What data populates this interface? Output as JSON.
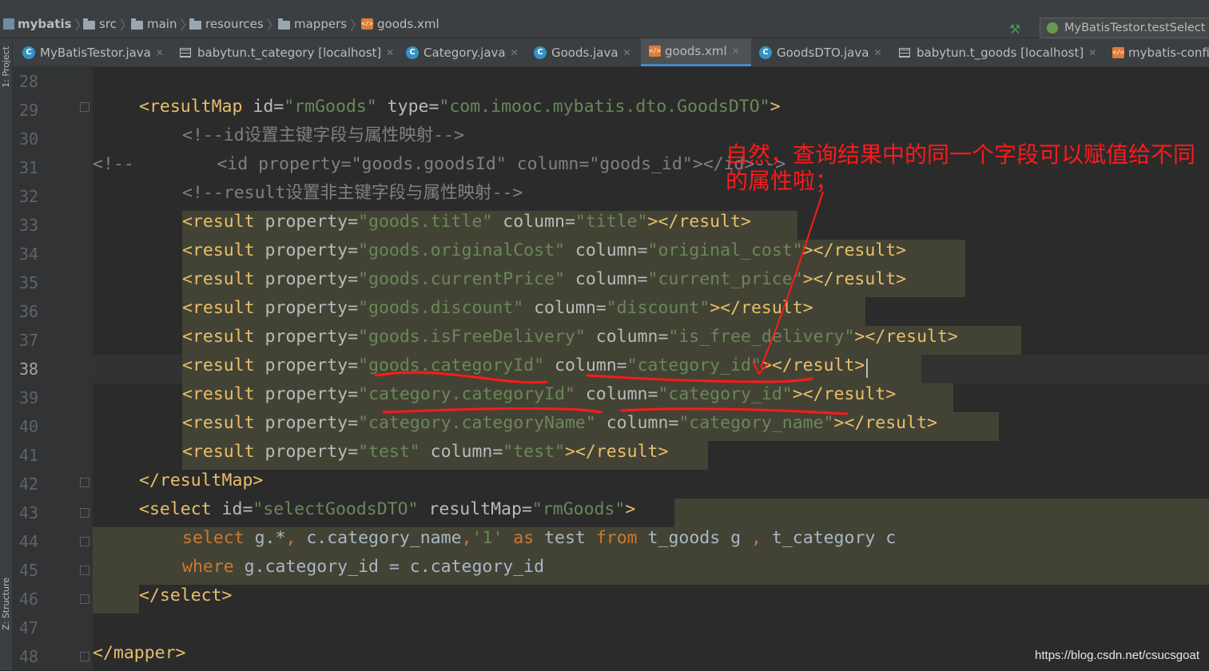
{
  "navbar": {
    "crumbs": [
      "mybatis",
      "src",
      "main",
      "resources",
      "mappers",
      "goods.xml"
    ],
    "run_config": "MyBatisTestor.testSelect"
  },
  "tabs": [
    {
      "label": "MyBatisTestor.java",
      "icon": "java-class-icon"
    },
    {
      "label": "babytun.t_category [localhost]",
      "icon": "table-icon"
    },
    {
      "label": "Category.java",
      "icon": "java-class-icon"
    },
    {
      "label": "Goods.java",
      "icon": "java-class-icon"
    },
    {
      "label": "goods.xml",
      "icon": "xml-file-icon",
      "active": true
    },
    {
      "label": "GoodsDTO.java",
      "icon": "java-class-icon"
    },
    {
      "label": "babytun.t_goods [localhost]",
      "icon": "table-icon"
    },
    {
      "label": "mybatis-confi",
      "icon": "xml-file-icon"
    }
  ],
  "side": {
    "project": "1: Project",
    "structure": "Z: Structure"
  },
  "line_numbers": [
    "28",
    "29",
    "30",
    "31",
    "32",
    "33",
    "34",
    "35",
    "36",
    "37",
    "38",
    "39",
    "40",
    "41",
    "42",
    "43",
    "44",
    "45",
    "46",
    "47",
    "48"
  ],
  "code": {
    "l29": {
      "t1": "<resultMap",
      "a1": " id=",
      "v1": "\"rmGoods\"",
      "a2": " type=",
      "v2": "\"com.imooc.mybatis.dto.GoodsDTO\"",
      "t2": ">"
    },
    "l30": "<!--id设置主键字段与属性映射-->",
    "l31": "<!--        <id property=\"goods.goodsId\" column=\"goods_id\"></id>-->",
    "l32": "<!--result设置非主键字段与属性映射-->",
    "results": [
      {
        "property": "\"goods.title\"",
        "column": "\"title\""
      },
      {
        "property": "\"goods.originalCost\"",
        "column": "\"original_cost\""
      },
      {
        "property": "\"goods.currentPrice\"",
        "column": "\"current_price\""
      },
      {
        "property": "\"goods.discount\"",
        "column": "\"discount\""
      },
      {
        "property": "\"goods.isFreeDelivery\"",
        "column": "\"is_free_delivery\""
      },
      {
        "property": "\"goods.categoryId\"",
        "column": "\"category_id\""
      },
      {
        "property": "\"category.categoryId\"",
        "column": "\"category_id\""
      },
      {
        "property": "\"category.categoryName\"",
        "column": "\"category_name\""
      },
      {
        "property": "\"test\"",
        "column": "\"test\""
      }
    ],
    "result_open": "<result",
    "result_close": "></result>",
    "property_attr": " property=",
    "column_attr": " column=",
    "l42": "</resultMap>",
    "l43": {
      "t1": "<select",
      "a1": " id=",
      "v1": "\"selectGoodsDTO\"",
      "a2": " resultMap=",
      "v2": "\"rmGoods\"",
      "t2": ">"
    },
    "l44": {
      "k1": "select",
      "p1": " g.*",
      "k2": ",",
      "p2": " c.category_name",
      "k3": ",",
      "v1": "'1'",
      "k4": " as",
      "p3": " test ",
      "k5": "from",
      "p4": " t_goods g ",
      "k6": ",",
      "p5": " t_category c"
    },
    "l45": {
      "k1": "where",
      "p1": " g.category_id = c.category_id"
    },
    "l46": "</select>",
    "l48": "</mapper>"
  },
  "annotation": "自然，查询结果中的同一个字段可以赋值给不同的属性啦；",
  "watermark": "https://blog.csdn.net/csucsgoat",
  "colors": {
    "tag": "#e8bf6a",
    "string": "#6a8759",
    "comment": "#808080",
    "keyword": "#cc7832",
    "annotation": "#ff1a1a"
  }
}
